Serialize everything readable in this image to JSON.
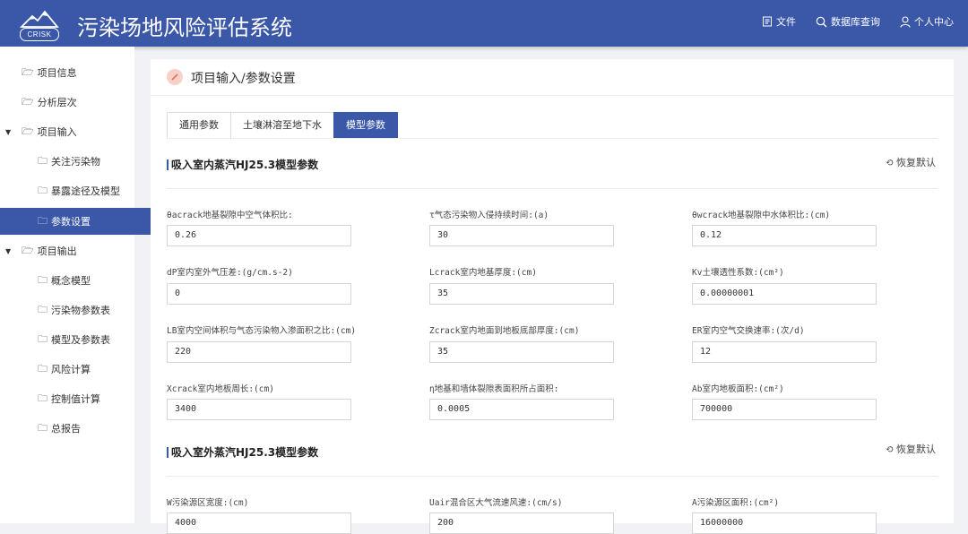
{
  "header": {
    "logo_text": "CRISK",
    "title": "污染场地风险评估系统",
    "nav": [
      {
        "label": "文件",
        "icon": "document-icon"
      },
      {
        "label": "数据库查询",
        "icon": "search-icon"
      },
      {
        "label": "个人中心",
        "icon": "user-icon"
      }
    ]
  },
  "sidebar": {
    "items": [
      {
        "label": "项目信息"
      },
      {
        "label": "分析层次"
      },
      {
        "label": "项目输入"
      },
      {
        "label": "关注污染物"
      },
      {
        "label": "暴露途径及模型"
      },
      {
        "label": "参数设置"
      },
      {
        "label": "项目输出"
      },
      {
        "label": "概念模型"
      },
      {
        "label": "污染物参数表"
      },
      {
        "label": "模型及参数表"
      },
      {
        "label": "风险计算"
      },
      {
        "label": "控制值计算"
      },
      {
        "label": "总报告"
      }
    ]
  },
  "page": {
    "title": "项目输入/参数设置",
    "tabs": [
      "通用参数",
      "土壤淋溶至地下水",
      "模型参数"
    ]
  },
  "section1": {
    "title": "吸入室内蒸汽HJ25.3模型参数",
    "reset": "恢复默认",
    "fields": [
      {
        "label": "θacrack地基裂隙中空气体积比:",
        "value": "0.26"
      },
      {
        "label": "τ气态污染物入侵持续时间:(a)",
        "value": "30"
      },
      {
        "label": "θwcrack地基裂隙中水体积比:(cm)",
        "value": "0.12"
      },
      {
        "label": "dP室内室外气压差:(g/cm.s-2)",
        "value": "0"
      },
      {
        "label": "Lcrack室内地基厚度:(cm)",
        "value": "35"
      },
      {
        "label": "Kv土壤透性系数:(cm²)",
        "value": "0.00000001"
      },
      {
        "label": "LB室内空间体积与气态污染物入渗面积之比:(cm)",
        "value": "220"
      },
      {
        "label": "Zcrack室内地面到地板底部厚度:(cm)",
        "value": "35"
      },
      {
        "label": "ER室内空气交换速率:(次/d)",
        "value": "12"
      },
      {
        "label": "Xcrack室内地板周长:(cm)",
        "value": "3400"
      },
      {
        "label": "η地基和墙体裂隙表面积所占面积:",
        "value": "0.0005"
      },
      {
        "label": "Ab室内地板面积:(cm²)",
        "value": "700000"
      }
    ]
  },
  "section2": {
    "title": "吸入室外蒸汽HJ25.3模型参数",
    "reset": "恢复默认",
    "fields": [
      {
        "label": "W污染源区宽度:(cm)",
        "value": "4000"
      },
      {
        "label": "Uair混合区大气流速风速:(cm/s)",
        "value": "200"
      },
      {
        "label": "A污染源区面积:(cm²)",
        "value": "16000000"
      }
    ]
  }
}
